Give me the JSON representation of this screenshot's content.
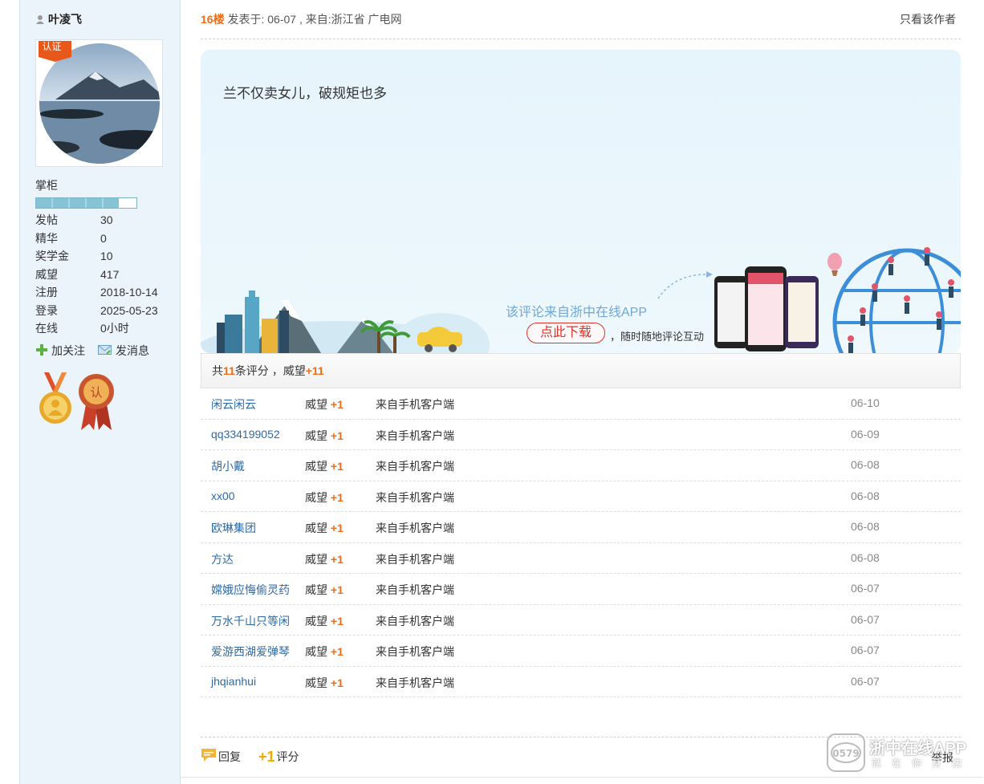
{
  "user": {
    "name": "叶凌飞",
    "cert_label": "认证",
    "rank": "掌柜",
    "rank_progress": 0.82,
    "stats": [
      {
        "key": "发帖",
        "value": "30"
      },
      {
        "key": "精华",
        "value": "0"
      },
      {
        "key": "奖学金",
        "value": "10"
      },
      {
        "key": "威望",
        "value": "417"
      },
      {
        "key": "注册",
        "value": "2018-10-14"
      },
      {
        "key": "登录",
        "value": "2025-05-23"
      },
      {
        "key": "在线",
        "value": "0小时"
      }
    ],
    "follow_label": "加关注",
    "message_label": "发消息"
  },
  "post": {
    "floor": "16楼",
    "meta": "发表于: 06-07 , 来自:浙江省 广电网",
    "only_author": "只看该作者",
    "content": "兰不仅卖女儿，破规矩也多"
  },
  "banner": {
    "line1": "该评论来自浙中在线APP",
    "button": "点此下载",
    "line2": "，随时随地评论互动"
  },
  "ratings": {
    "summary_prefix": "共",
    "count": "11",
    "summary_mid": "条评分 ，威望",
    "total": "+11",
    "rows": [
      {
        "user": "闲云闲云",
        "label": "威望",
        "value": "+1",
        "source": "来自手机客户端",
        "date": "06-10"
      },
      {
        "user": "qq334199052",
        "label": "威望",
        "value": "+1",
        "source": "来自手机客户端",
        "date": "06-09"
      },
      {
        "user": "胡小戴",
        "label": "威望",
        "value": "+1",
        "source": "来自手机客户端",
        "date": "06-08"
      },
      {
        "user": "xx00",
        "label": "威望",
        "value": "+1",
        "source": "来自手机客户端",
        "date": "06-08"
      },
      {
        "user": "欧琳集团",
        "label": "威望",
        "value": "+1",
        "source": "来自手机客户端",
        "date": "06-08"
      },
      {
        "user": "方达",
        "label": "威望",
        "value": "+1",
        "source": "来自手机客户端",
        "date": "06-08"
      },
      {
        "user": "嫦娥应悔偷灵药",
        "label": "威望",
        "value": "+1",
        "source": "来自手机客户端",
        "date": "06-07"
      },
      {
        "user": "万水千山只等闲",
        "label": "威望",
        "value": "+1",
        "source": "来自手机客户端",
        "date": "06-07"
      },
      {
        "user": "爱游西湖爱弹琴",
        "label": "威望",
        "value": "+1",
        "source": "来自手机客户端",
        "date": "06-07"
      },
      {
        "user": "jhqianhui",
        "label": "威望",
        "value": "+1",
        "source": "来自手机客户端",
        "date": "06-07"
      }
    ]
  },
  "footer": {
    "reply": "回复",
    "rate_mark": "+1",
    "rate": "评分",
    "report": "举报"
  },
  "watermark": {
    "title": "浙中在线APP",
    "subtitle": "就在你身边",
    "logo_text": "0579"
  },
  "colors": {
    "accent": "#ef6d18",
    "link": "#2e6aa6",
    "sidebar_bg": "#ebf3fb"
  }
}
